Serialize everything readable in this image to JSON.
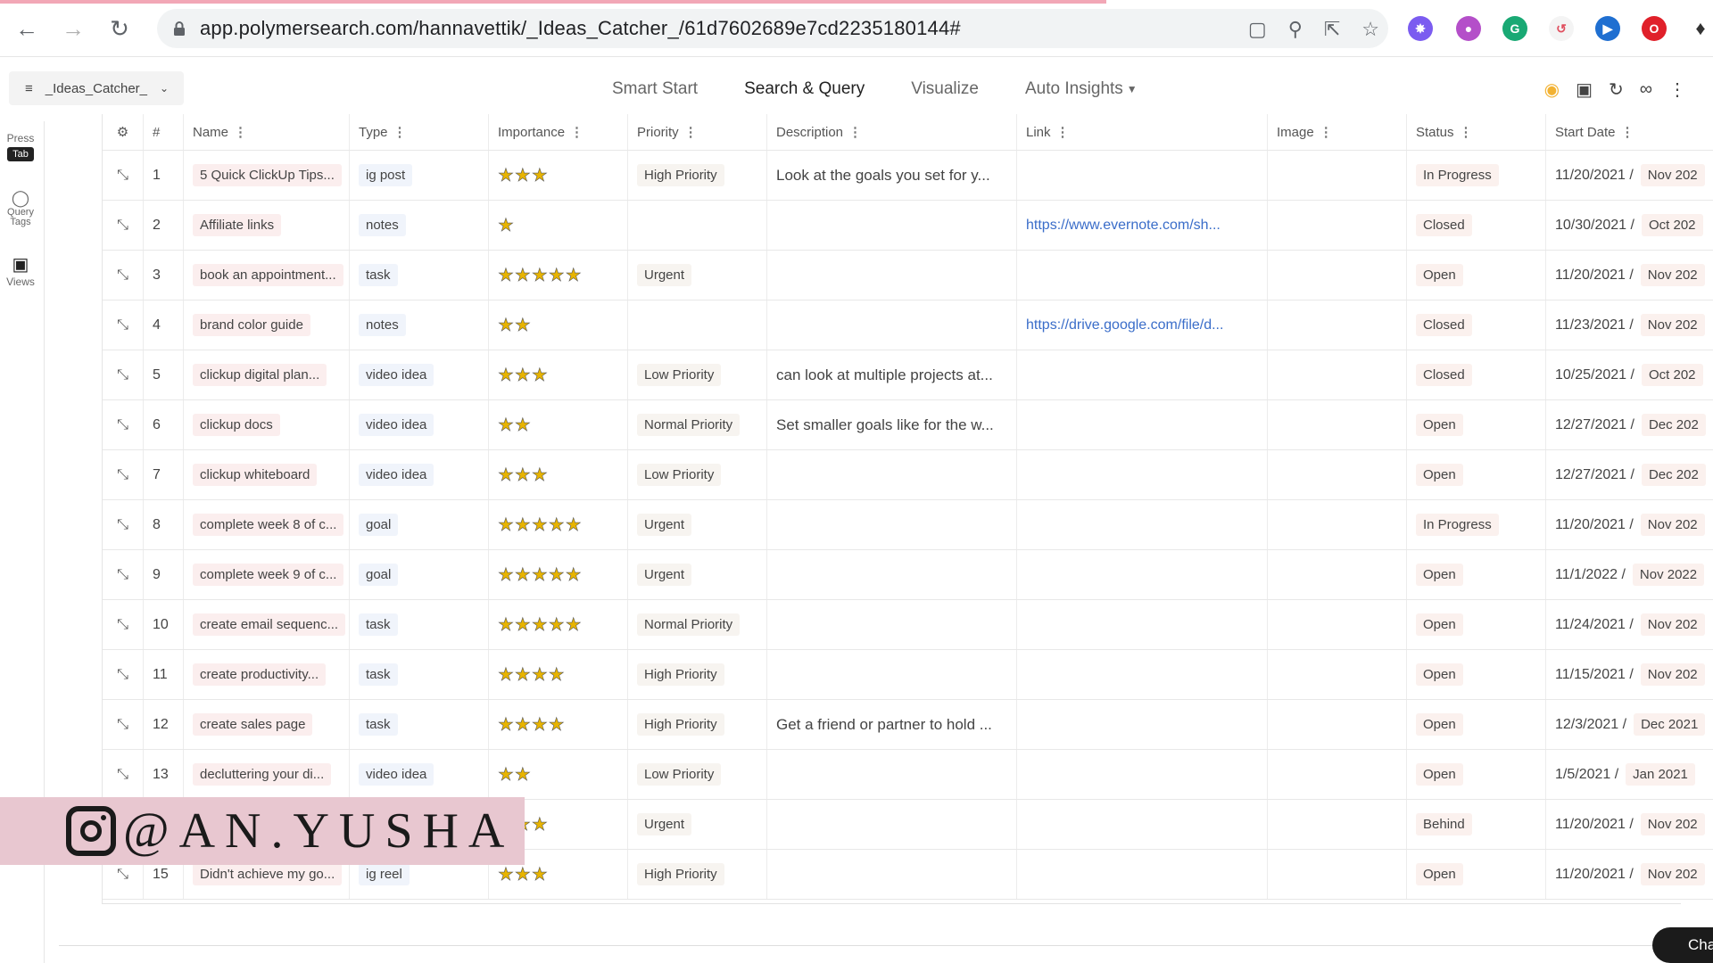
{
  "browser": {
    "url": "app.polymersearch.com/hannavettik/_Ideas_Catcher_/61d7602689e7cd2235180144#"
  },
  "app": {
    "dataset_name": "_Ideas_Catcher_",
    "tabs": [
      {
        "label": "Smart Start"
      },
      {
        "label": "Search & Query"
      },
      {
        "label": "Visualize"
      },
      {
        "label": "Auto Insights"
      }
    ]
  },
  "rail": {
    "press_label": "Press",
    "tab_key": "Tab",
    "query_tags_label": "Query Tags",
    "views_label": "Views"
  },
  "table": {
    "columns": {
      "num": "#",
      "name": "Name",
      "type": "Type",
      "importance": "Importance",
      "priority": "Priority",
      "description": "Description",
      "link": "Link",
      "image": "Image",
      "status": "Status",
      "start_date": "Start Date"
    },
    "rows": [
      {
        "num": "1",
        "name": "5 Quick ClickUp Tips...",
        "type": "ig post",
        "importance": 3,
        "priority": "High Priority",
        "description": "Look at the goals you set for y...",
        "link": "",
        "status": "In Progress",
        "date": "11/20/2021 /",
        "month": "Nov 202"
      },
      {
        "num": "2",
        "name": "Affiliate links",
        "type": "notes",
        "importance": 1,
        "priority": "",
        "description": "",
        "link": "https://www.evernote.com/sh...",
        "status": "Closed",
        "date": "10/30/2021 /",
        "month": "Oct 202"
      },
      {
        "num": "3",
        "name": "book an appointment...",
        "type": "task",
        "importance": 5,
        "priority": "Urgent",
        "description": "",
        "link": "",
        "status": "Open",
        "date": "11/20/2021 /",
        "month": "Nov 202"
      },
      {
        "num": "4",
        "name": "brand color guide",
        "type": "notes",
        "importance": 2,
        "priority": "",
        "description": "",
        "link": "https://drive.google.com/file/d...",
        "status": "Closed",
        "date": "11/23/2021 /",
        "month": "Nov 202"
      },
      {
        "num": "5",
        "name": "clickup digital plan...",
        "type": "video idea",
        "importance": 3,
        "priority": "Low Priority",
        "description": "can look at multiple projects at...",
        "link": "",
        "status": "Closed",
        "date": "10/25/2021 /",
        "month": "Oct 202"
      },
      {
        "num": "6",
        "name": "clickup docs",
        "type": "video idea",
        "importance": 2,
        "priority": "Normal Priority",
        "description": "Set smaller goals like for the w...",
        "link": "",
        "status": "Open",
        "date": "12/27/2021 /",
        "month": "Dec 202"
      },
      {
        "num": "7",
        "name": "clickup whiteboard",
        "type": "video idea",
        "importance": 3,
        "priority": "Low Priority",
        "description": "",
        "link": "",
        "status": "Open",
        "date": "12/27/2021 /",
        "month": "Dec 202"
      },
      {
        "num": "8",
        "name": "complete week 8 of c...",
        "type": "goal",
        "importance": 5,
        "priority": "Urgent",
        "description": "",
        "link": "",
        "status": "In Progress",
        "date": "11/20/2021 /",
        "month": "Nov 202"
      },
      {
        "num": "9",
        "name": "complete week 9 of c...",
        "type": "goal",
        "importance": 5,
        "priority": "Urgent",
        "description": "",
        "link": "",
        "status": "Open",
        "date": "11/1/2022 /",
        "month": "Nov 2022"
      },
      {
        "num": "10",
        "name": "create email sequenc...",
        "type": "task",
        "importance": 5,
        "priority": "Normal Priority",
        "description": "",
        "link": "",
        "status": "Open",
        "date": "11/24/2021 /",
        "month": "Nov 202"
      },
      {
        "num": "11",
        "name": "create productivity...",
        "type": "task",
        "importance": 4,
        "priority": "High Priority",
        "description": "",
        "link": "",
        "status": "Open",
        "date": "11/15/2021 /",
        "month": "Nov 202"
      },
      {
        "num": "12",
        "name": "create sales page",
        "type": "task",
        "importance": 4,
        "priority": "High Priority",
        "description": "Get a friend or partner to hold ...",
        "link": "",
        "status": "Open",
        "date": "12/3/2021 /",
        "month": "Dec 2021"
      },
      {
        "num": "13",
        "name": "decluttering your di...",
        "type": "video idea",
        "importance": 2,
        "priority": "Low Priority",
        "description": "",
        "link": "",
        "status": "Open",
        "date": "1/5/2021 /",
        "month": "Jan 2021"
      },
      {
        "num": "14",
        "name": "",
        "type": "",
        "importance": 3,
        "priority": "Urgent",
        "description": "",
        "link": "",
        "status": "Behind",
        "date": "11/20/2021 /",
        "month": "Nov 202"
      },
      {
        "num": "15",
        "name": "Didn't achieve my go...",
        "type": "ig reel",
        "importance": 3,
        "priority": "High Priority",
        "description": "",
        "link": "",
        "status": "Open",
        "date": "11/20/2021 /",
        "month": "Nov 202"
      }
    ]
  },
  "chat_label": "Chat",
  "watermark": {
    "handle": "@AN.YUSHA"
  },
  "colors": {
    "tab_underline": "#f0a77c",
    "link": "#3a6dc9",
    "star": "#e8b400",
    "watermark_bg": "#e8c7d0"
  }
}
